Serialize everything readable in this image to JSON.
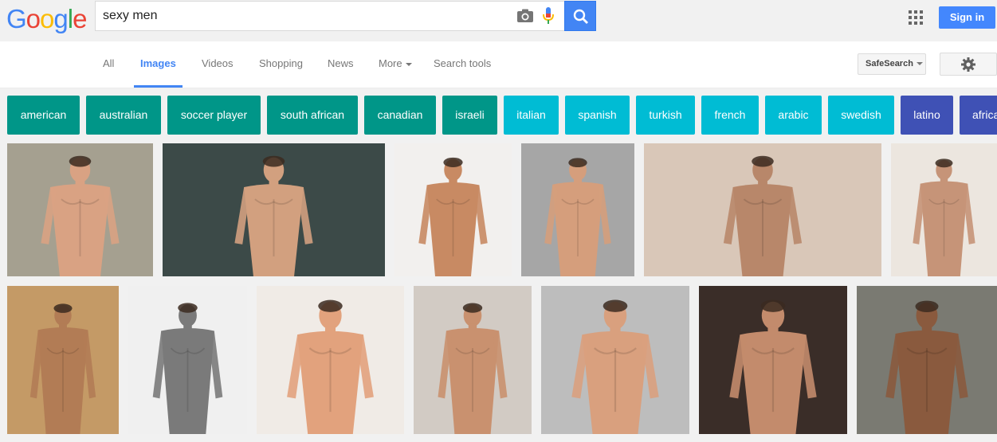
{
  "logo": {
    "text": "Google",
    "letters": [
      "G",
      "o",
      "o",
      "g",
      "l",
      "e"
    ],
    "colors": [
      "#4285f4",
      "#ea4335",
      "#fbbc05",
      "#4285f4",
      "#34a853",
      "#ea4335"
    ]
  },
  "search": {
    "query": "sexy men",
    "camera_icon": "camera-icon",
    "mic_icon": "microphone-icon",
    "button_icon": "search-icon"
  },
  "header": {
    "apps_icon": "apps-grid-icon",
    "signin_label": "Sign in"
  },
  "tabs": [
    {
      "label": "All"
    },
    {
      "label": "Images",
      "active": true
    },
    {
      "label": "Videos"
    },
    {
      "label": "Shopping"
    },
    {
      "label": "News"
    },
    {
      "label": "More"
    },
    {
      "label": "Search tools"
    }
  ],
  "safesearch": {
    "label": "SafeSearch"
  },
  "settings": {
    "icon": "gear-icon"
  },
  "chips": [
    {
      "label": "american",
      "color": "#009688"
    },
    {
      "label": "australian",
      "color": "#009688"
    },
    {
      "label": "soccer player",
      "color": "#009688"
    },
    {
      "label": "south african",
      "color": "#009688"
    },
    {
      "label": "canadian",
      "color": "#009688"
    },
    {
      "label": "israeli",
      "color": "#009688"
    },
    {
      "label": "italian",
      "color": "#00bcd4"
    },
    {
      "label": "spanish",
      "color": "#00bcd4"
    },
    {
      "label": "turkish",
      "color": "#00bcd4"
    },
    {
      "label": "french",
      "color": "#00bcd4"
    },
    {
      "label": "arabic",
      "color": "#00bcd4"
    },
    {
      "label": "swedish",
      "color": "#00bcd4"
    },
    {
      "label": "latino",
      "color": "#3f51b5"
    },
    {
      "label": "africa",
      "color": "#3f51b5"
    }
  ],
  "images": [
    {
      "bg": "#a5a090",
      "tone": "#d9a283"
    },
    {
      "bg": "#3c4a48",
      "tone": "#d2a07f"
    },
    {
      "bg": "#f2f0ee",
      "tone": "#c88a63"
    },
    {
      "bg": "#a6a6a6",
      "tone": "#d59e7c"
    },
    {
      "bg": "#d9c7b8",
      "tone": "#b8876a"
    },
    {
      "bg": "#ece6df",
      "tone": "#c69478"
    },
    {
      "bg": "#c49a66",
      "tone": "#b27c55"
    },
    {
      "bg": "#f0f0f0",
      "tone": "#7a7a7a"
    },
    {
      "bg": "#f0ebe6",
      "tone": "#e2a27d"
    },
    {
      "bg": "#d2cbc4",
      "tone": "#c9916f"
    },
    {
      "bg": "#bdbdbd",
      "tone": "#d9a07e"
    },
    {
      "bg": "#3a2d28",
      "tone": "#c38b6c"
    },
    {
      "bg": "#7a7a72",
      "tone": "#8a5a3e"
    }
  ]
}
